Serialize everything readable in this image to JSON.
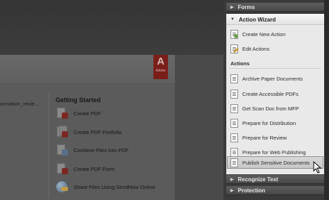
{
  "welcome": {
    "logo_text": "Adobe",
    "recent_file": "ormation_revie...",
    "getting_started_title": "Getting Started",
    "items": [
      {
        "label": "Create PDF",
        "icon": "create-pdf-icon"
      },
      {
        "label": "Create PDF Portfolio",
        "icon": "pdf-portfolio-icon"
      },
      {
        "label": "Combine Files into PDF",
        "icon": "combine-files-icon"
      },
      {
        "label": "Create PDF Form",
        "icon": "pdf-form-icon"
      },
      {
        "label": "Share Files Using SendNow Online",
        "icon": "sendnow-globe-icon"
      }
    ]
  },
  "pane": {
    "forms": "Forms",
    "action_wizard": "Action Wizard",
    "create_new_action": "Create New Action",
    "edit_actions": "Edit Actions",
    "actions_label": "Actions",
    "actions": [
      "Archive Paper Documents",
      "Create Accessible PDFs",
      "Get Scan Doc from MFP",
      "Prepare for Distribution",
      "Prepare for Review",
      "Prepare for Web Publishing",
      "Publish Sensitive Documents"
    ],
    "recognize_text": "Recognize Text",
    "protection": "Protection"
  },
  "colors": {
    "selected_item": "#c8c8c8",
    "pane_header": "#484848",
    "adobe_red": "#7a1e1a"
  }
}
